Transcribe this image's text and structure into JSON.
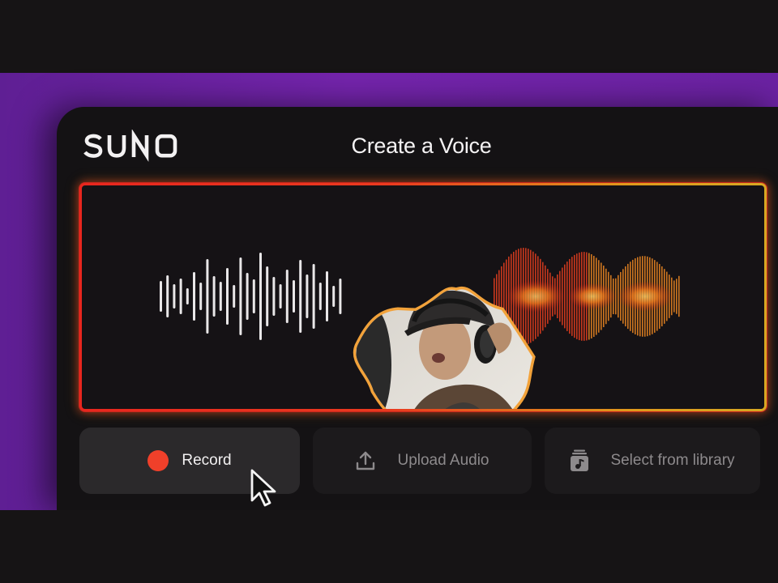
{
  "app": {
    "logo_text": "SUNO",
    "page_title": "Create a Voice"
  },
  "actions": {
    "record_label": "Record",
    "upload_label": "Upload Audio",
    "library_label": "Select from library"
  },
  "icons": {
    "record": "record-dot-icon",
    "upload": "upload-icon",
    "library": "music-library-icon",
    "cursor": "mouse-pointer-icon"
  },
  "colors": {
    "background": "#161415",
    "purple_accent": "#7424ac",
    "panel": "#141214",
    "record_red": "#f0402a",
    "wave_red": "#e8261e",
    "wave_orange": "#f07a1e",
    "wave_yellow": "#f5c242",
    "record_button_bg": "#2b292b",
    "secondary_button_bg": "#1c1a1c"
  }
}
